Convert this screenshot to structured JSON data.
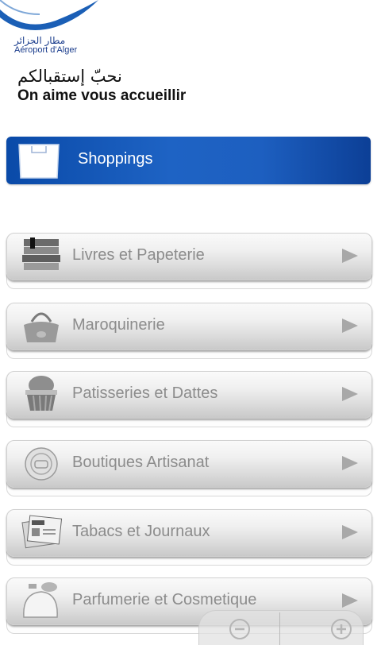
{
  "header": {
    "logo_arabic": "مطار الجزائر",
    "logo_french": "Aéroport d'Alger",
    "tagline_arabic": "نحبّ إستقبالكم",
    "tagline_french": "On aime vous accueillir"
  },
  "titlebar": {
    "title": "Shoppings",
    "icon": "shopping-bag-icon",
    "color": "#1a5cbd"
  },
  "menu": {
    "items": [
      {
        "label": "Livres et Papeterie",
        "icon": "books-icon"
      },
      {
        "label": "Maroquinerie",
        "icon": "handbag-icon"
      },
      {
        "label": "Patisseries et Dattes",
        "icon": "cupcake-icon"
      },
      {
        "label": "Boutiques Artisanat",
        "icon": "craft-plate-icon"
      },
      {
        "label": "Tabacs et Journaux",
        "icon": "newspaper-icon"
      },
      {
        "label": "Parfumerie et Cosmetique",
        "icon": "perfume-bottle-icon"
      }
    ]
  },
  "zoom": {
    "out_icon": "zoom-out-icon",
    "in_icon": "zoom-in-icon"
  }
}
